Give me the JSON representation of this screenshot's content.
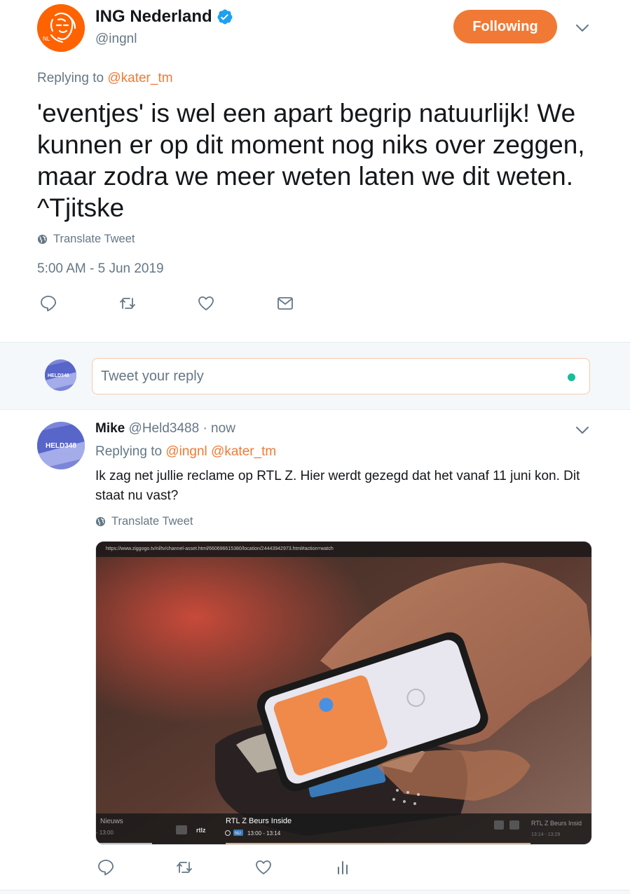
{
  "colors": {
    "accent": "#f07a35",
    "brand_orange": "#ff6200",
    "verified_blue": "#1da1f2",
    "secondary_text": "#657786",
    "online_dot": "#17bf99"
  },
  "main_tweet": {
    "author": {
      "name": "ING Nederland",
      "handle": "@ingnl",
      "verified": true,
      "avatar_icon": "ing-lion-logo",
      "avatar_text": "NL"
    },
    "follow_button_label": "Following",
    "replying_prefix": "Replying to",
    "replying_to": "@kater_tm",
    "text": "'eventjes' is wel een apart begrip natuurlijk! We kunnen er op dit moment nog niks over zeggen, maar zodra we meer weten laten we dit weten. ^Tjitske",
    "translate_label": "Translate Tweet",
    "timestamp": "5:00 AM - 5 Jun 2019",
    "actions": [
      "reply-icon",
      "retweet-icon",
      "like-icon",
      "dm-icon"
    ]
  },
  "reply_composer": {
    "placeholder": "Tweet your reply",
    "avatar_text": "HELD348"
  },
  "reply_tweet": {
    "author": {
      "name": "Mike",
      "handle": "@Held3488",
      "time": "· now",
      "avatar_text": "HELD348"
    },
    "replying_prefix": "Replying to",
    "replying_to": [
      "@ingnl",
      "@kater_tm"
    ],
    "text": "Ik zag net jullie reclame op RTL Z. Hier werdt gezegd dat het vanaf 11 juni kon. Dit staat nu vast?",
    "translate_label": "Translate Tweet",
    "media": {
      "url_text": "https://www.ziggogo.tv/nl/tv/channel-asset.html/660696615380/location/24443942973.html#action=watch",
      "left_channel_label": "Nieuws",
      "left_channel_time": "- 13:00",
      "channel_logo": "rtlz",
      "program_title": "RTL Z Beurs Inside",
      "program_badge": "NU",
      "program_time": "13:00 - 13:14",
      "next_program_title": "RTL Z Beurs Insid",
      "next_program_time": "13:14 - 13:29"
    },
    "actions": [
      "reply-icon",
      "retweet-icon",
      "like-icon",
      "analytics-icon"
    ]
  }
}
